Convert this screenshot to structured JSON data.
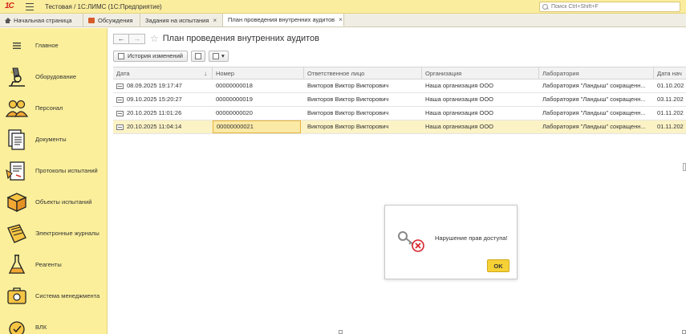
{
  "titlebar": {
    "logo_text": "1С",
    "app_title": "Тестовая / 1С:ЛИМС  (1С:Предприятие)",
    "search_placeholder": "Поиск Ctrl+Shift+F"
  },
  "tabs": [
    {
      "label": "Начальная страница",
      "icon": "home-icon"
    },
    {
      "label": "Обсуждения",
      "icon": "discussions-icon"
    },
    {
      "label": "Задания на испытания",
      "close": "×"
    },
    {
      "label": "План проведения внутренних аудитов",
      "close": "×"
    }
  ],
  "sidebar": {
    "items": [
      {
        "label": "Главное",
        "icon": "hamburger-icon"
      },
      {
        "label": "Оборудование",
        "icon": "microscope-icon"
      },
      {
        "label": "Персонал",
        "icon": "people-icon"
      },
      {
        "label": "Документы",
        "icon": "documents-icon"
      },
      {
        "label": "Протоколы испытаний",
        "icon": "protocol-icon"
      },
      {
        "label": "Объекты испытаний",
        "icon": "box-icon"
      },
      {
        "label": "Электронные журналы",
        "icon": "journal-icon"
      },
      {
        "label": "Реагенты",
        "icon": "flask-icon"
      },
      {
        "label": "Система менеджмента",
        "icon": "management-icon"
      },
      {
        "label": "ВЛК",
        "icon": "vlk-icon"
      }
    ]
  },
  "page": {
    "title": "План проведения внутренних аудитов",
    "back": "←",
    "forward": "→",
    "star": "☆"
  },
  "toolbar": {
    "history_label": "История изменений",
    "print_caret": "▾"
  },
  "table": {
    "columns": [
      "Дата",
      "Номер",
      "Ответственное лицо",
      "Организация",
      "Лаборатория",
      "Дата нач"
    ],
    "sort_arrow": "↓",
    "rows": [
      [
        "08.09.2025 19:17:47",
        "00000000018",
        "Викторов Виктор Викторович",
        "Наша организация ООО",
        "Лаборатория \"Ландыш\" сокращенн...",
        "01.10.202"
      ],
      [
        "09.10.2025 15:20:27",
        "00000000019",
        "Викторов Виктор Викторович",
        "Наша организация ООО",
        "Лаборатория \"Ландыш\" сокращенн...",
        "03.11.202"
      ],
      [
        "20.10.2025 11:01:26",
        "00000000020",
        "Викторов Виктор Викторович",
        "Наша организация ООО",
        "Лаборатория \"Ландыш\" сокращенн...",
        "01.11.202"
      ],
      [
        "20.10.2025 11:04:14",
        "00000000021",
        "Викторов Виктор Викторович",
        "Наша организация ООО",
        "Лаборатория \"Ландыш\" сокращенн...",
        "01.11.202"
      ]
    ],
    "selected_row": 3
  },
  "dialog": {
    "message": "Нарушение прав доступа!",
    "ok_label": "OK"
  },
  "colors": {
    "sidebar_bg": "#fbef9b",
    "accent_button": "#f5d136",
    "selected_row": "#fbf2c6",
    "error_red": "#d8232a"
  }
}
